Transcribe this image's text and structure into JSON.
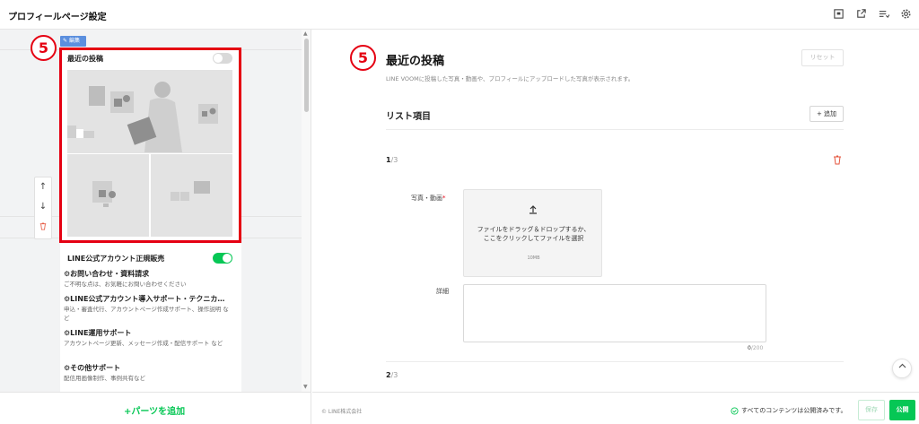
{
  "header": {
    "title": "プロフィールページ設定",
    "icons": [
      "layout-icon",
      "external-link-icon",
      "list-settings-icon",
      "gear-icon"
    ]
  },
  "markers": {
    "step": "5"
  },
  "preview": {
    "edit_badge": "編集",
    "recent_posts": {
      "title": "最近の投稿",
      "enabled": false
    },
    "shop": {
      "title": "LINE公式アカウント正規販売",
      "enabled": true,
      "items": [
        {
          "name": "お問い合わせ・資料請求",
          "desc": "ご不明な点は、お気軽にお問い合わせください"
        },
        {
          "name": "LINE公式アカウント導入サポート・テクニカ…",
          "desc": "申込・審査代行、アカウントページ作成サポート、操作説明 など"
        },
        {
          "name": "LINE運用サポート",
          "desc": "アカウントページ更新、メッセージ作成・配信サポート など"
        },
        {
          "name": "その他サポート",
          "desc": "配信用画像制作、事例共有など"
        }
      ]
    },
    "add_parts": "+パーツを追加"
  },
  "editor": {
    "title": "最近の投稿",
    "reset": "リセット",
    "description": "LINE VOOMに投稿した写真・動画や、プロフィールにアップロードした写真が表示されます。",
    "list_label": "リスト項目",
    "add_label": "追加",
    "item1": {
      "index": "1",
      "total": "/3"
    },
    "media_label": "写真・動画",
    "required_mark": "*",
    "upload_text": "ファイルをドラッグ＆ドロップするか、ここをクリックしてファイルを選択",
    "upload_size": "10MB",
    "detail_label": "詳細",
    "counter_value": "0",
    "counter_max": "/200",
    "item2": {
      "index": "2",
      "total": "/3"
    }
  },
  "footer": {
    "copyright": "© LINE株式会社",
    "status": "すべてのコンテンツは公開済みです。",
    "save": "保存",
    "publish": "公開"
  },
  "colors": {
    "accent": "#06c755",
    "highlight": "#e50012",
    "badge": "#5b8fde"
  }
}
